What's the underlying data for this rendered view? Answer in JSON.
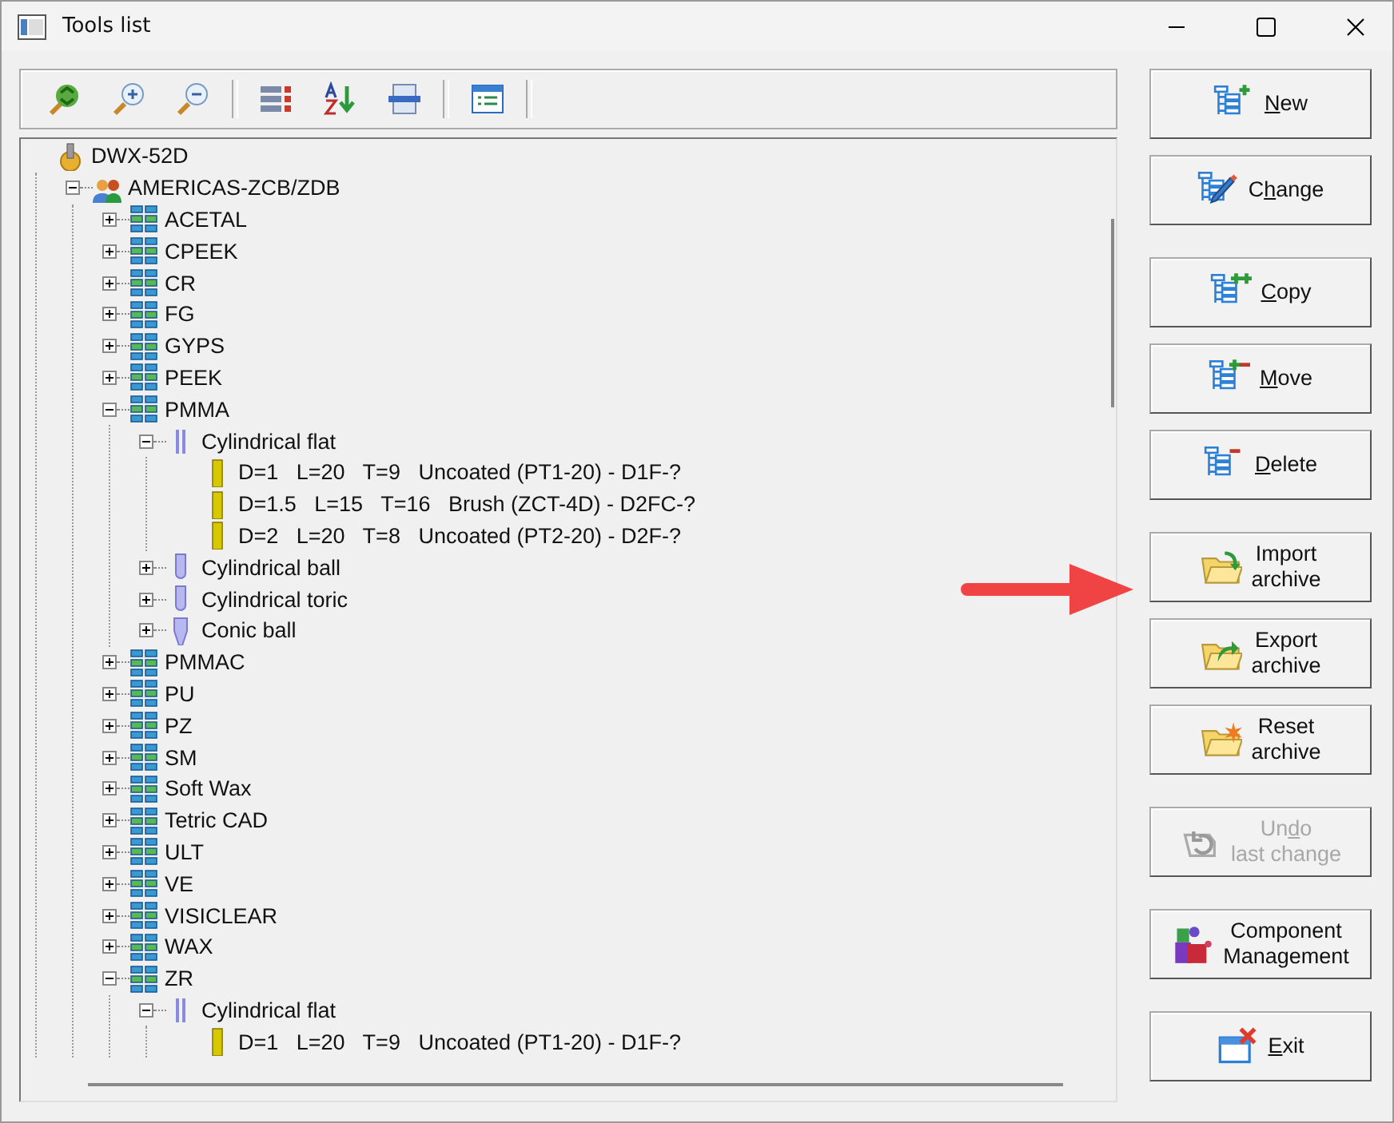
{
  "window": {
    "title": "Tools list"
  },
  "tree": [
    {
      "kind": "machine",
      "label": "DWX-52D",
      "children": [
        {
          "kind": "group",
          "label": "AMERICAS-ZCB/ZDB",
          "expanded": true,
          "children": [
            {
              "kind": "material",
              "label": "ACETAL",
              "expanded": false
            },
            {
              "kind": "material",
              "label": "CPEEK",
              "expanded": false
            },
            {
              "kind": "material",
              "label": "CR",
              "expanded": false
            },
            {
              "kind": "material",
              "label": "FG",
              "expanded": false
            },
            {
              "kind": "material",
              "label": "GYPS",
              "expanded": false
            },
            {
              "kind": "material",
              "label": "PEEK",
              "expanded": false
            },
            {
              "kind": "material",
              "label": "PMMA",
              "expanded": true,
              "children": [
                {
                  "kind": "tool_flat",
                  "label": "Cylindrical flat",
                  "expanded": true,
                  "children": [
                    {
                      "kind": "tool",
                      "label": "D=1   L=20   T=9   Uncoated (PT1-20) - D1F-?"
                    },
                    {
                      "kind": "tool",
                      "label": "D=1.5   L=15   T=16   Brush (ZCT-4D) - D2FC-?"
                    },
                    {
                      "kind": "tool",
                      "label": "D=2   L=20   T=8   Uncoated (PT2-20) - D2F-?"
                    }
                  ]
                },
                {
                  "kind": "tool_ball",
                  "label": "Cylindrical ball",
                  "expanded": false
                },
                {
                  "kind": "tool_ball",
                  "label": "Cylindrical toric",
                  "expanded": false
                },
                {
                  "kind": "tool_conic",
                  "label": "Conic ball",
                  "expanded": false
                }
              ]
            },
            {
              "kind": "material",
              "label": "PMMAC",
              "expanded": false
            },
            {
              "kind": "material",
              "label": "PU",
              "expanded": false
            },
            {
              "kind": "material",
              "label": "PZ",
              "expanded": false
            },
            {
              "kind": "material",
              "label": "SM",
              "expanded": false
            },
            {
              "kind": "material",
              "label": "Soft Wax",
              "expanded": false
            },
            {
              "kind": "material",
              "label": "Tetric CAD",
              "expanded": false
            },
            {
              "kind": "material",
              "label": "ULT",
              "expanded": false
            },
            {
              "kind": "material",
              "label": "VE",
              "expanded": false
            },
            {
              "kind": "material",
              "label": "VISICLEAR",
              "expanded": false
            },
            {
              "kind": "material",
              "label": "WAX",
              "expanded": false
            },
            {
              "kind": "material",
              "label": "ZR",
              "expanded": true,
              "children": [
                {
                  "kind": "tool_flat",
                  "label": "Cylindrical flat",
                  "expanded": true,
                  "children": [
                    {
                      "kind": "tool",
                      "label": "D=1   L=20   T=9   Uncoated (PT1-20) - D1F-?"
                    }
                  ]
                }
              ]
            }
          ]
        }
      ]
    }
  ],
  "buttons": [
    {
      "kind": "new",
      "mnemonic": "N",
      "after": "ew",
      "disabled": false
    },
    {
      "kind": "change",
      "before": "C",
      "mnemonic": "h",
      "after": "ange",
      "disabled": false
    },
    {
      "kind": "copy",
      "mnemonic": "C",
      "after": "opy",
      "disabled": false
    },
    {
      "kind": "move",
      "mnemonic": "M",
      "after": "ove",
      "disabled": false
    },
    {
      "kind": "delete",
      "mnemonic": "D",
      "after": "elete",
      "disabled": false
    },
    {
      "kind": "import",
      "before": "Import",
      "second_line": "archive",
      "disabled": false
    },
    {
      "kind": "export",
      "before": "Export",
      "second_line": "archive",
      "disabled": false
    },
    {
      "kind": "reset",
      "before": "Reset",
      "second_line": "archive",
      "disabled": false
    },
    {
      "kind": "undo",
      "before": "Un",
      "mnemonic": "d",
      "after": "o",
      "second_line": "last change",
      "disabled": true
    },
    {
      "kind": "component",
      "before": "Component",
      "second_line": "Management",
      "disabled": false
    },
    {
      "kind": "exit",
      "mnemonic": "E",
      "after": "xit",
      "disabled": false
    }
  ]
}
